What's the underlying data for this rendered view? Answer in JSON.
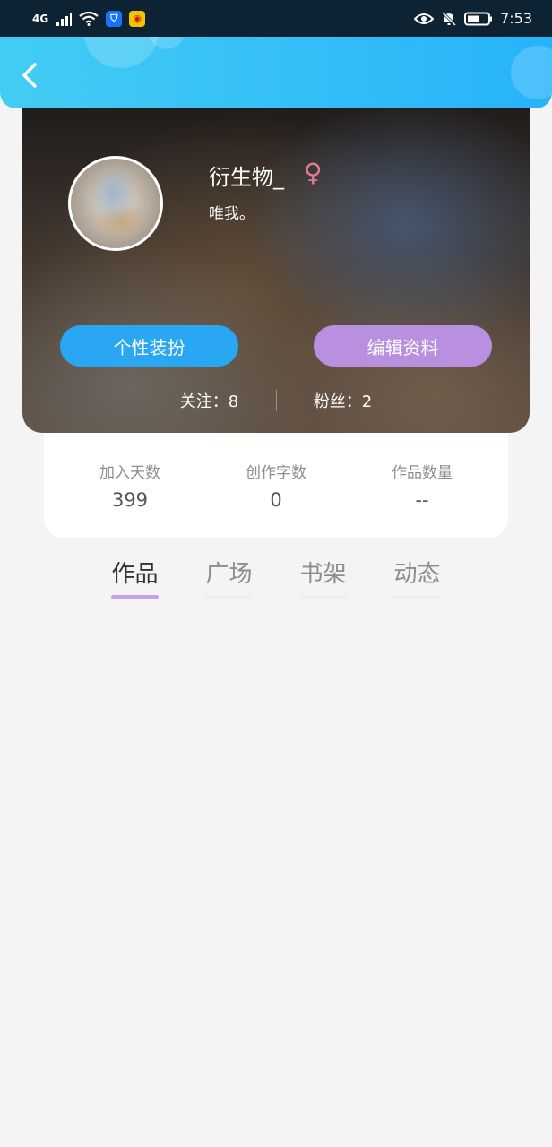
{
  "status_bar": {
    "network": "4G",
    "signal_icon": "signal-icon",
    "wifi_icon": "wifi-icon",
    "app_icons": [
      "shield-app-icon",
      "weibo-icon"
    ],
    "right_icons": [
      "eye-icon",
      "mute-bell-icon",
      "battery-icon"
    ],
    "time": "7:53"
  },
  "header": {
    "back_icon": "chevron-left-icon",
    "color": "#2fbdf8"
  },
  "profile": {
    "username": "衍生物_",
    "gender_icon": "female-symbol-icon",
    "gender_symbol": "♀",
    "bio": "唯我。",
    "dress_up_label": "个性装扮",
    "edit_profile_label": "编辑资料",
    "following_label": "关注",
    "following_count": "8",
    "fans_label": "粉丝",
    "fans_count": "2",
    "dress_up_color": "#2aa7f2",
    "edit_color": "#b98fdf",
    "gender_color": "#e07b93"
  },
  "stats": [
    {
      "label": "加入天数",
      "value": "399"
    },
    {
      "label": "创作字数",
      "value": "0"
    },
    {
      "label": "作品数量",
      "value": "--"
    }
  ],
  "tabs": [
    {
      "label": "作品",
      "active": true
    },
    {
      "label": "广场",
      "active": false
    },
    {
      "label": "书架",
      "active": false
    },
    {
      "label": "动态",
      "active": false
    }
  ],
  "colors": {
    "page_background": "#f4f4f4",
    "active_tab_indicator": "#c8a0e6"
  }
}
